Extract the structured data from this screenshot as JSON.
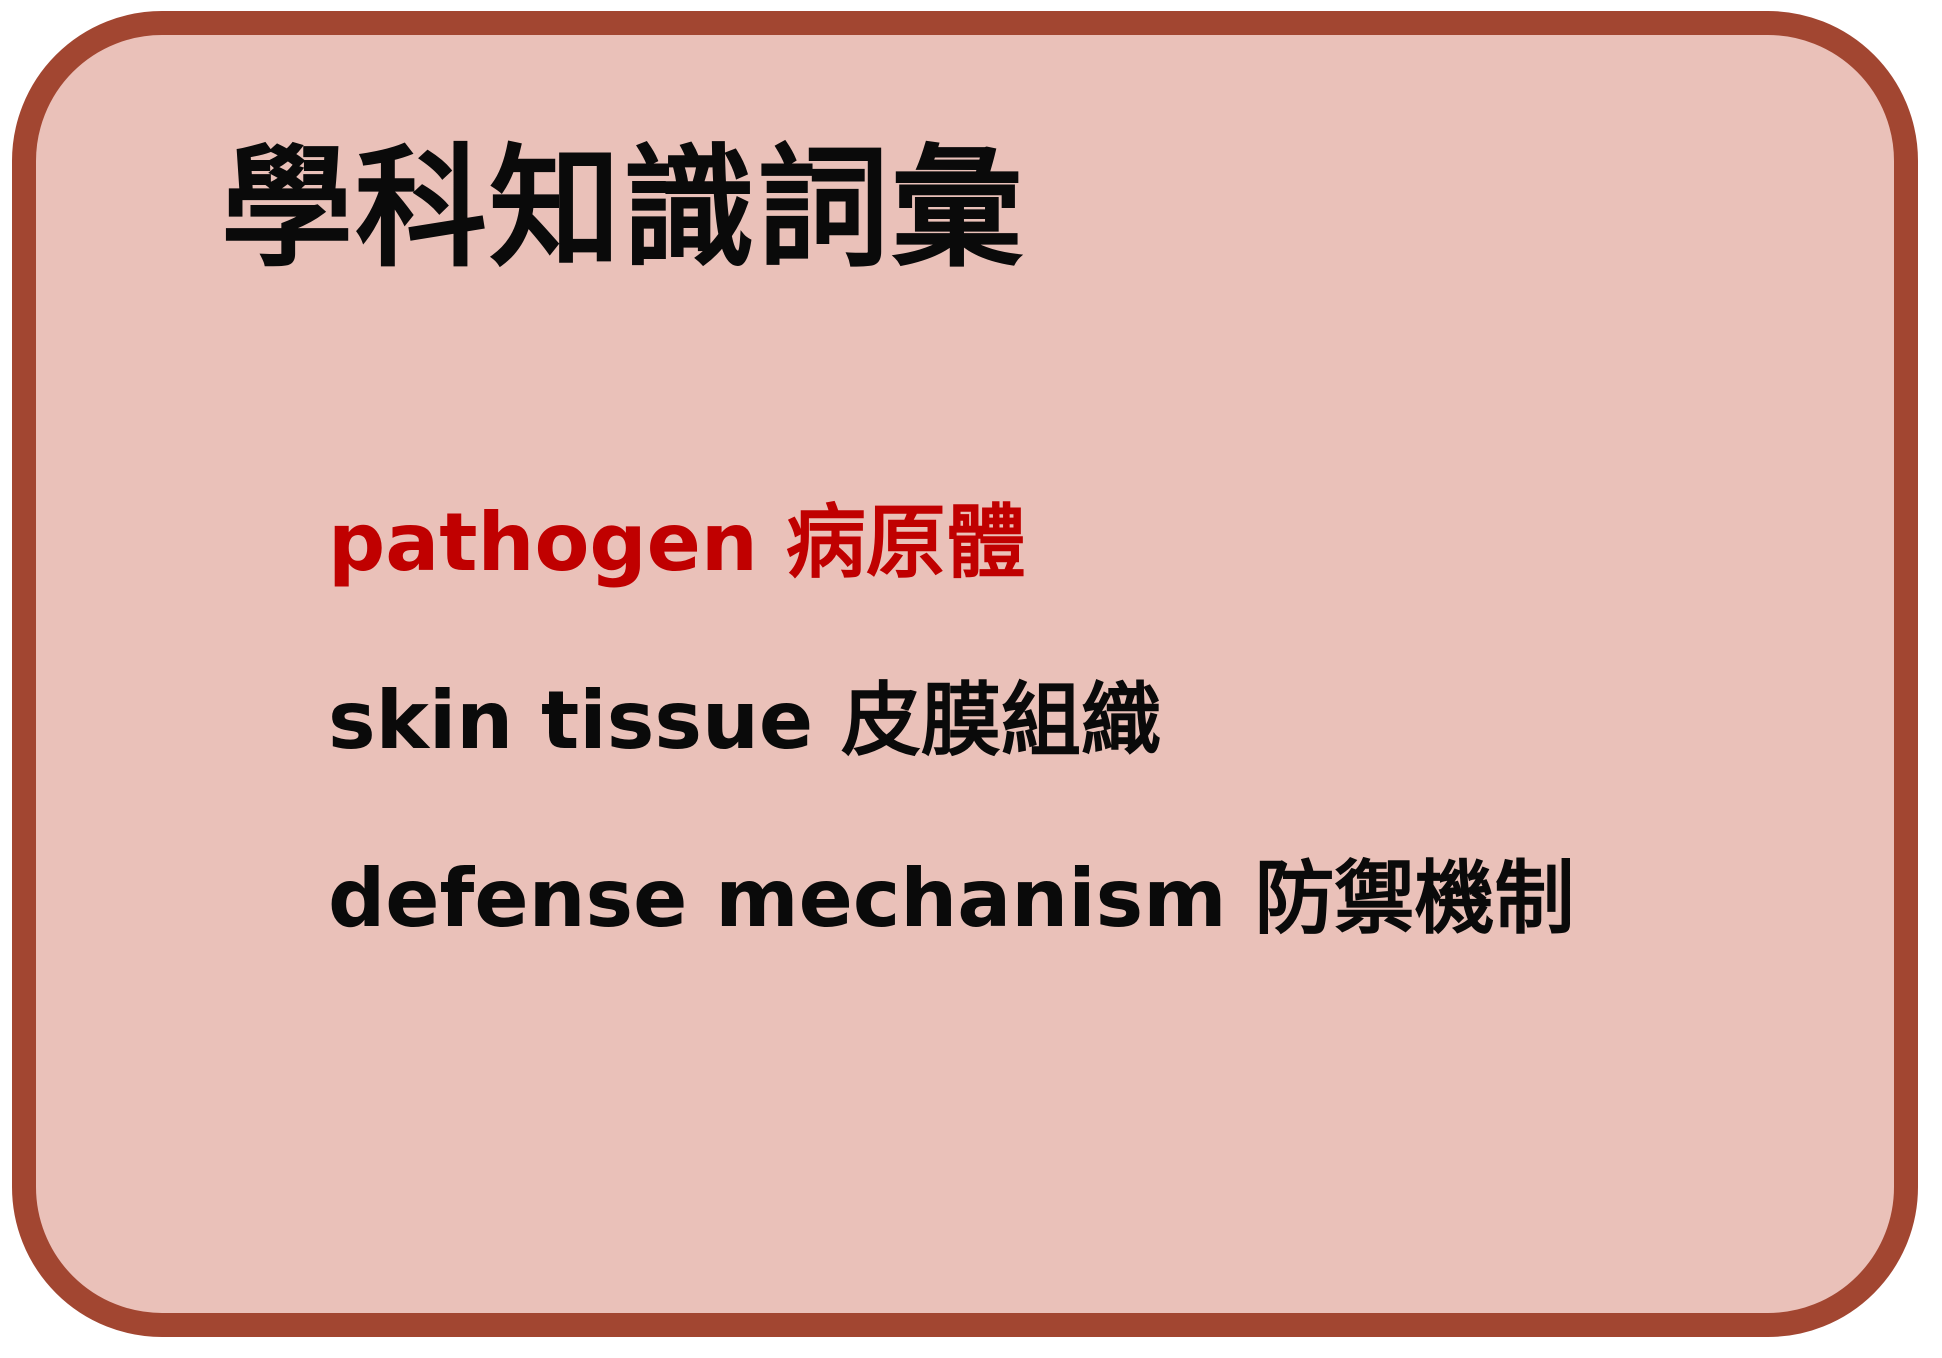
{
  "title": "學科知識詞彙",
  "vocabulary": [
    {
      "text": "pathogen 病原體",
      "highlighted": true
    },
    {
      "text": "skin tissue 皮膜組織",
      "highlighted": false
    },
    {
      "text": "defense mechanism 防禦機制",
      "highlighted": false
    }
  ],
  "colors": {
    "border": "#a24631",
    "background": "#eac1b9",
    "highlight": "#c00000",
    "text": "#0a0a0a"
  }
}
